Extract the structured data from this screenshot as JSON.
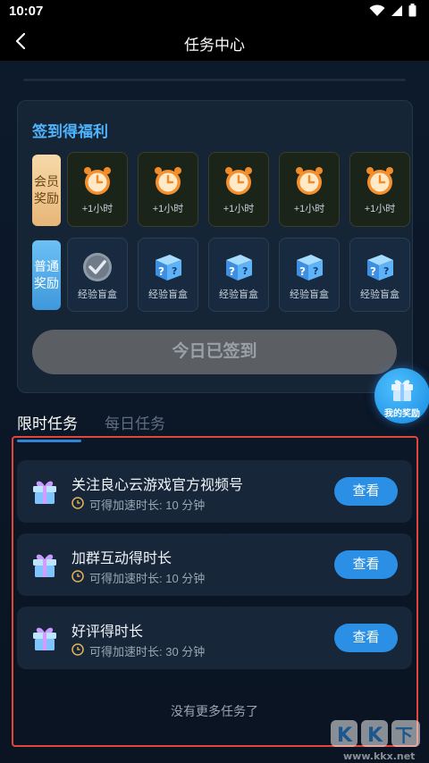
{
  "status_bar": {
    "time": "10:07"
  },
  "nav": {
    "title": "任务中心"
  },
  "signin": {
    "title": "签到得福利",
    "vip_label": "会员奖励",
    "normal_label": "普通奖励",
    "vip_rewards": [
      "+1小时",
      "+1小时",
      "+1小时",
      "+1小时",
      "+1小时"
    ],
    "normal_rewards": [
      "经验盲盒",
      "经验盲盒",
      "经验盲盒",
      "经验盲盒",
      "经验盲盒"
    ],
    "signed_button": "今日已签到"
  },
  "reward_fab": {
    "label": "我的奖励"
  },
  "tabs": {
    "limited": "限时任务",
    "daily": "每日任务"
  },
  "tasks": [
    {
      "title": "关注良心云游戏官方视频号",
      "sub": "可得加速时长: 10 分钟",
      "button": "查看"
    },
    {
      "title": "加群互动得时长",
      "sub": "可得加速时长: 10 分钟",
      "button": "查看"
    },
    {
      "title": "好评得时长",
      "sub": "可得加速时长: 30 分钟",
      "button": "查看"
    }
  ],
  "footer": {
    "no_more": "没有更多任务了"
  },
  "watermark": {
    "text": "KK下载 www.kkx.net"
  },
  "colors": {
    "accent": "#2b8fe6",
    "title_blue": "#4fb4ff",
    "highlight_frame": "#e2463a"
  }
}
